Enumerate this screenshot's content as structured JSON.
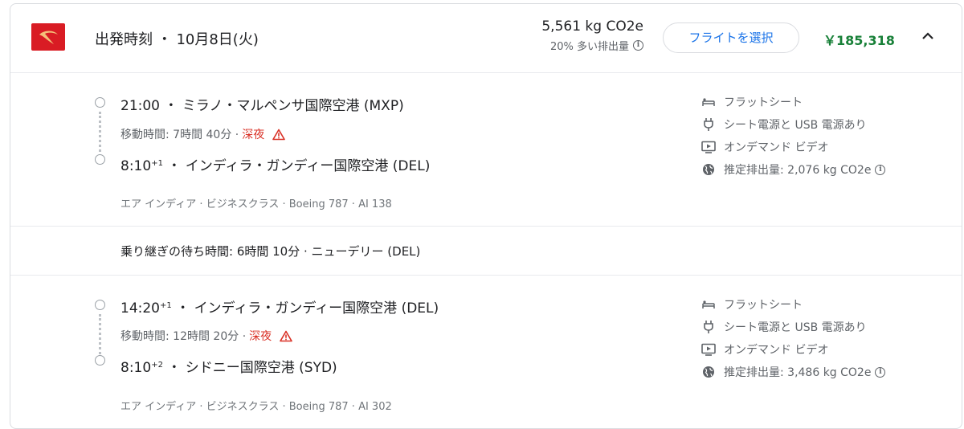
{
  "header": {
    "title": "出発時刻 ・ 10月8日(火)",
    "emissions_value": "5,561 kg CO2e",
    "emissions_note": "20% 多い排出量",
    "select_label": "フライトを選択",
    "price": "￥185,318",
    "logo_color": "#d91c24",
    "price_color": "#188038",
    "accent_color": "#1a73e8"
  },
  "segments": [
    {
      "depart_time": "21:00",
      "depart_sup": "",
      "depart_airport": "ミラノ・マルペンサ国際空港 (MXP)",
      "duration": "移動時間: 7時間 40分 · ",
      "overnight": "深夜",
      "arrive_time": "8:10",
      "arrive_sup": "+1",
      "arrive_airport": "インディラ・ガンディー国際空港 (DEL)",
      "meta": "エア インディア · ビジネスクラス · Boeing 787 · AI 138",
      "amenities": {
        "seat": "フラットシート",
        "power": "シート電源と USB 電源あり",
        "video": "オンデマンド ビデオ",
        "emissions": "推定排出量: 2,076 kg CO2e"
      }
    },
    {
      "depart_time": "14:20",
      "depart_sup": "+1",
      "depart_airport": "インディラ・ガンディー国際空港 (DEL)",
      "duration": "移動時間: 12時間 20分 · ",
      "overnight": "深夜",
      "arrive_time": "8:10",
      "arrive_sup": "+2",
      "arrive_airport": "シドニー国際空港 (SYD)",
      "meta": "エア インディア · ビジネスクラス · Boeing 787 · AI 302",
      "amenities": {
        "seat": "フラットシート",
        "power": "シート電源と USB 電源あり",
        "video": "オンデマンド ビデオ",
        "emissions": "推定排出量: 3,486 kg CO2e"
      }
    }
  ],
  "layover": "乗り継ぎの待ち時間: 6時間 10分 · ニューデリー (DEL)",
  "icons": {
    "logo": "airline-logo",
    "info": "info-icon",
    "warning": "warning-icon",
    "chevron": "chevron-up-icon",
    "seat": "flat-seat-icon",
    "power": "power-plug-icon",
    "video": "video-icon",
    "globe": "globe-icon"
  }
}
